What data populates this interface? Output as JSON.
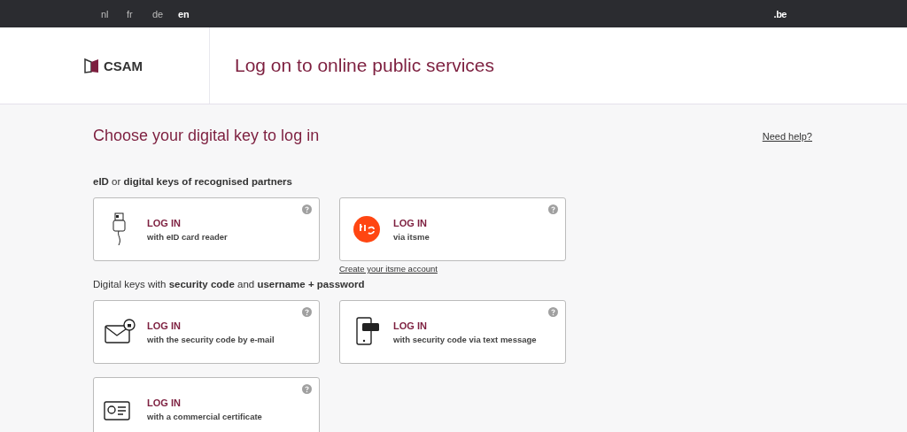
{
  "top_bar": {
    "languages": [
      {
        "label": "nl",
        "selected": false
      },
      {
        "label": "fr",
        "selected": false
      },
      {
        "label": "de",
        "selected": false
      },
      {
        "label": "en",
        "selected": true
      }
    ],
    "brand": ".be"
  },
  "header": {
    "logo": "CSAM",
    "title": "Log on to online public services"
  },
  "main": {
    "title": "Choose your digital key to log in",
    "help_link": "Need help?",
    "sections": [
      {
        "heading": "**eID** or **digital keys of recognised partners**",
        "cards": [
          {
            "kind": "card-reader",
            "title": "LOG IN",
            "subtitle": "with eID card reader"
          },
          {
            "kind": "itsme",
            "title": "LOG IN",
            "subtitle": "via itsme",
            "link": "Create your itsme account"
          }
        ]
      },
      {
        "heading": "Digital keys with **security code** and **username + password**",
        "cards": [
          {
            "kind": "email",
            "title": "LOG IN",
            "subtitle": "with the security code by e-mail"
          },
          {
            "kind": "sms",
            "title": "LOG IN",
            "subtitle": "with security code via text message"
          },
          {
            "kind": "certificate",
            "title": "LOG IN",
            "subtitle": "with a commercial certificate"
          }
        ]
      }
    ]
  }
}
